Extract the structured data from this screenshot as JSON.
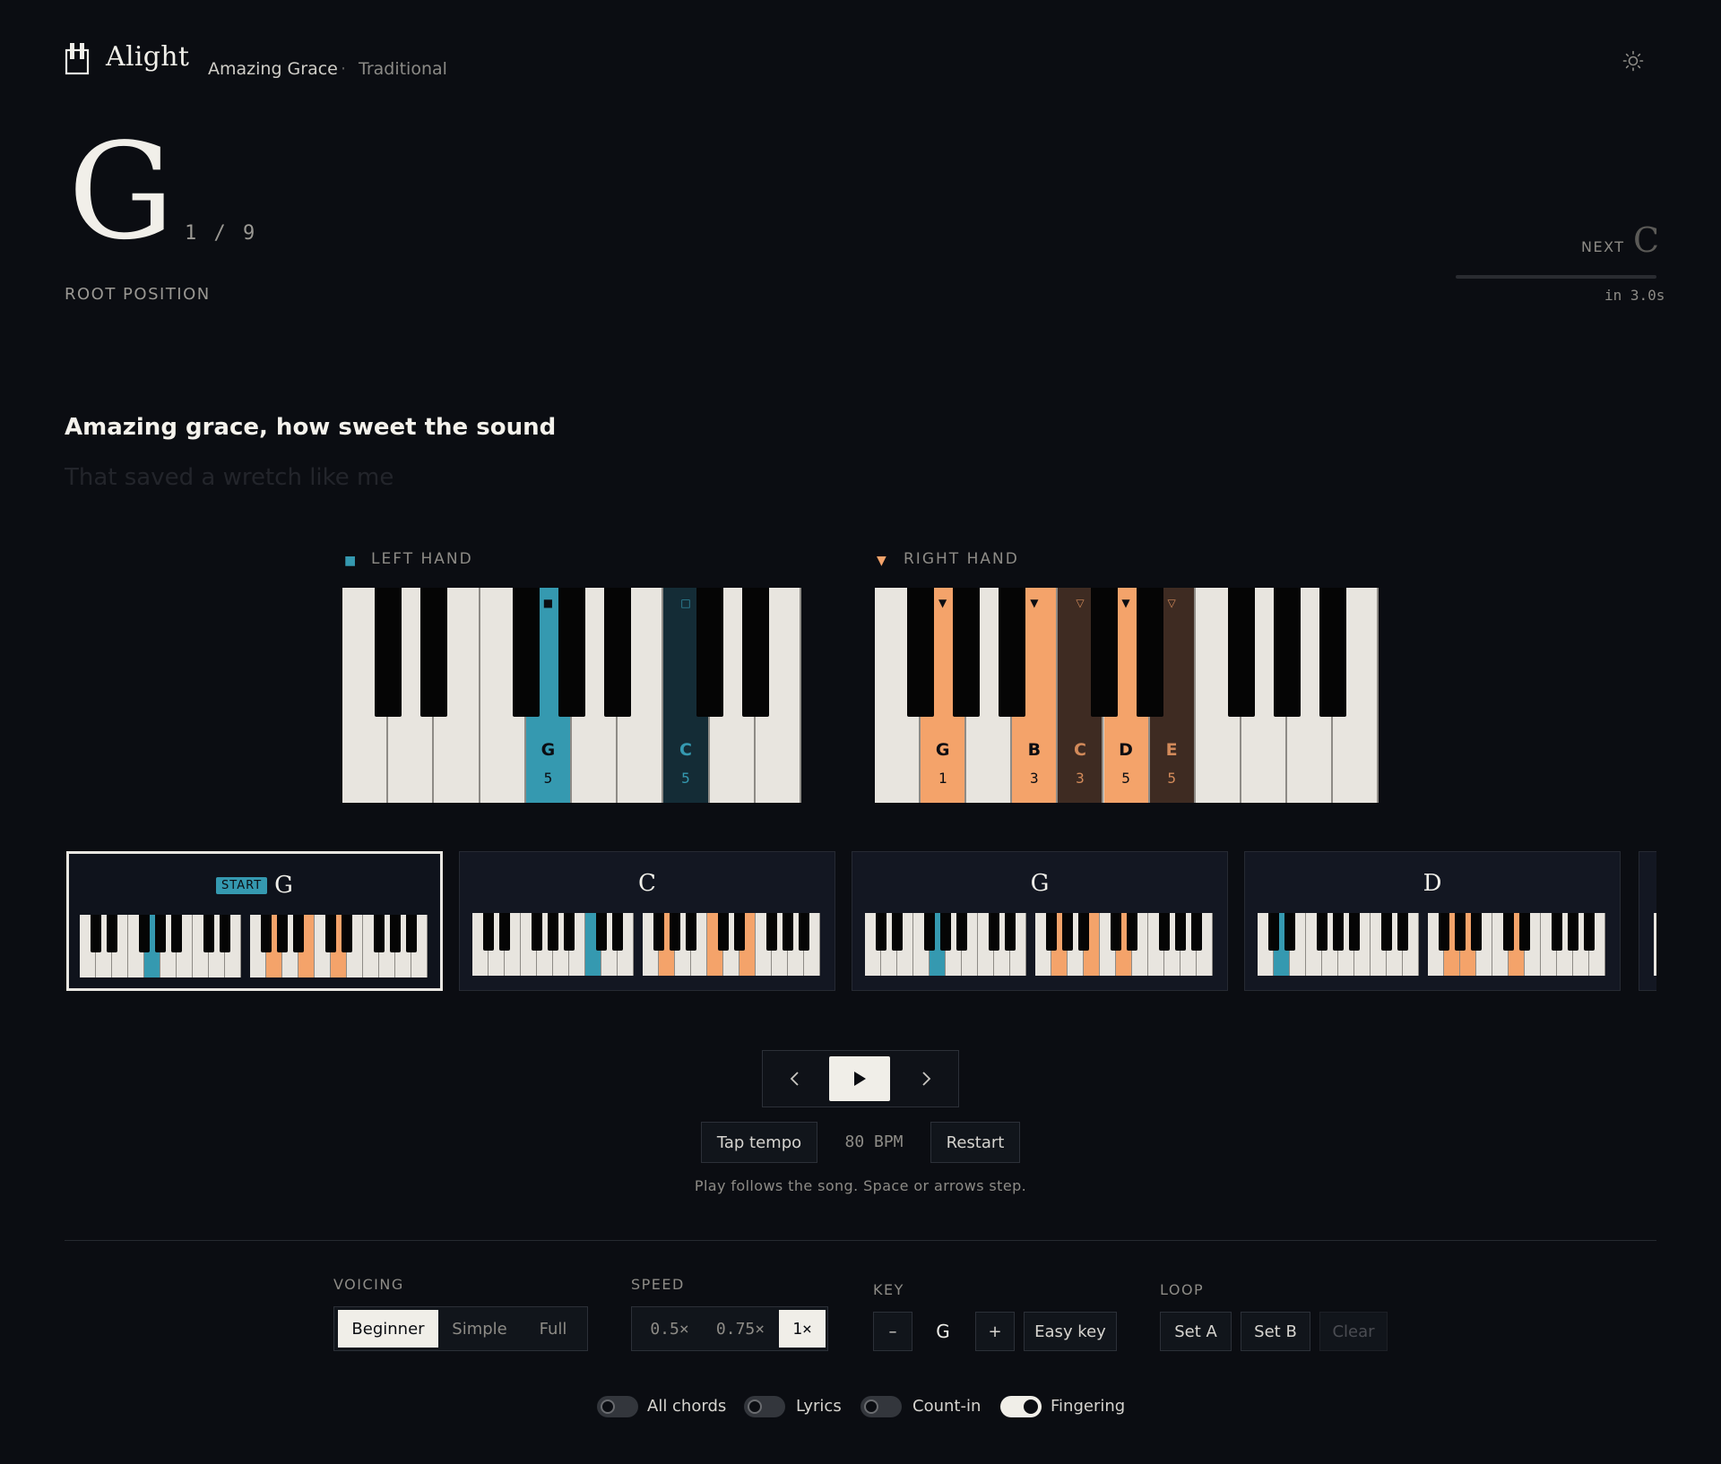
{
  "header": {
    "brand": "Alight",
    "song_title": "Amazing Grace",
    "separator": "·",
    "song_artist": "Traditional"
  },
  "current": {
    "chord": "G",
    "index": "1 / 9",
    "position": "ROOT POSITION",
    "next_label": "NEXT",
    "next_chord": "C",
    "next_progress": 0.0,
    "next_time": "in 3.0s"
  },
  "lyrics": {
    "current": "Amazing grace, how sweet the sound",
    "next": "That saved a wretch like me"
  },
  "hands": {
    "left": {
      "label": "LEFT HAND",
      "marker": "■",
      "keys": [
        {
          "note": "G",
          "finger": "5",
          "state": "active"
        },
        {
          "note": "C",
          "finger": "5",
          "state": "upcoming"
        }
      ]
    },
    "right": {
      "label": "RIGHT HAND",
      "marker": "▼",
      "keys": [
        {
          "note": "G",
          "finger": "1",
          "state": "active"
        },
        {
          "note": "B",
          "finger": "3",
          "state": "active"
        },
        {
          "note": "C",
          "finger": "3",
          "state": "upcoming"
        },
        {
          "note": "D",
          "finger": "5",
          "state": "active"
        },
        {
          "note": "E",
          "finger": "5",
          "state": "upcoming"
        }
      ]
    }
  },
  "progression": [
    {
      "chord": "G",
      "badge": "START",
      "active": true
    },
    {
      "chord": "C",
      "badge": "",
      "active": false
    },
    {
      "chord": "G",
      "badge": "",
      "active": false
    },
    {
      "chord": "D",
      "badge": "",
      "active": false
    }
  ],
  "transport": {
    "prev_icon": "chevron-left-icon",
    "play_icon": "play-icon",
    "next_icon": "chevron-right-icon",
    "tap_tempo": "Tap tempo",
    "bpm": "80 BPM",
    "restart": "Restart",
    "hint": "Play follows the song. Space or arrows step."
  },
  "settings": {
    "voicing": {
      "label": "VOICING",
      "options": [
        "Beginner",
        "Simple",
        "Full"
      ],
      "selected": "Beginner"
    },
    "speed": {
      "label": "SPEED",
      "options": [
        "0.5×",
        "0.75×",
        "1×"
      ],
      "selected": "1×"
    },
    "key": {
      "label": "KEY",
      "minus": "–",
      "value": "G",
      "plus": "+",
      "easy": "Easy key"
    },
    "loop": {
      "label": "LOOP",
      "set_a": "Set A",
      "set_b": "Set B",
      "clear": "Clear"
    }
  },
  "toggles": [
    {
      "label": "All chords",
      "on": false
    },
    {
      "label": "Lyrics",
      "on": false
    },
    {
      "label": "Count-in",
      "on": false
    },
    {
      "label": "Fingering",
      "on": true
    }
  ],
  "colors": {
    "left_active": "#3599b0",
    "left_upcoming": "#142c36",
    "right_active": "#f4a36a",
    "right_upcoming": "#3e2b22",
    "background": "#0b0d12"
  }
}
